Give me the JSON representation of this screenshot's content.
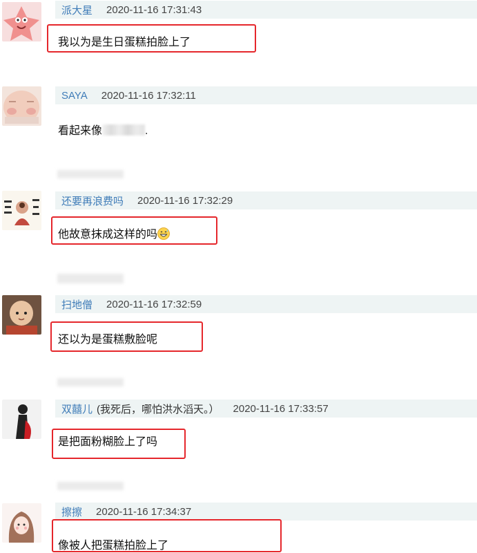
{
  "comments": [
    {
      "user": "派大星",
      "note": "",
      "time": "2020-11-16 17:31:43",
      "text": "我以为是生日蛋糕拍脸上了",
      "avatar_icon": "patrick-star-avatar-icon"
    },
    {
      "user": "SAYA",
      "note": "",
      "time": "2020-11-16 17:32:11",
      "text": "看起来像",
      "text_suffix": ".",
      "avatar_icon": "baby-face-avatar-icon"
    },
    {
      "user": "还要再浪费吗",
      "note": "",
      "time": "2020-11-16 17:32:29",
      "text": "他故意抹成这样的吗",
      "emoji": "grinning-sweat-emoji-icon",
      "avatar_icon": "buddha-calligraphy-avatar-icon"
    },
    {
      "user": "扫地僧",
      "note": "",
      "time": "2020-11-16 17:32:59",
      "text": "还以为是蛋糕敷脸呢",
      "avatar_icon": "little-monk-avatar-icon"
    },
    {
      "user": "双囍儿",
      "note": "(我死后，哪怕洪水滔天。）",
      "time": "2020-11-16 17:33:57",
      "text": "是把面粉糊脸上了吗",
      "avatar_icon": "silhouette-avatar-icon"
    },
    {
      "user": "擦擦",
      "note": "",
      "time": "2020-11-16 17:34:37",
      "text": "像被人把蛋糕拍脸上了",
      "avatar_icon": "drawn-girl-avatar-icon"
    }
  ],
  "colors": {
    "highlight": "#e5262b",
    "username": "#3f7cb8",
    "meta_bg": "#eef4f4"
  }
}
